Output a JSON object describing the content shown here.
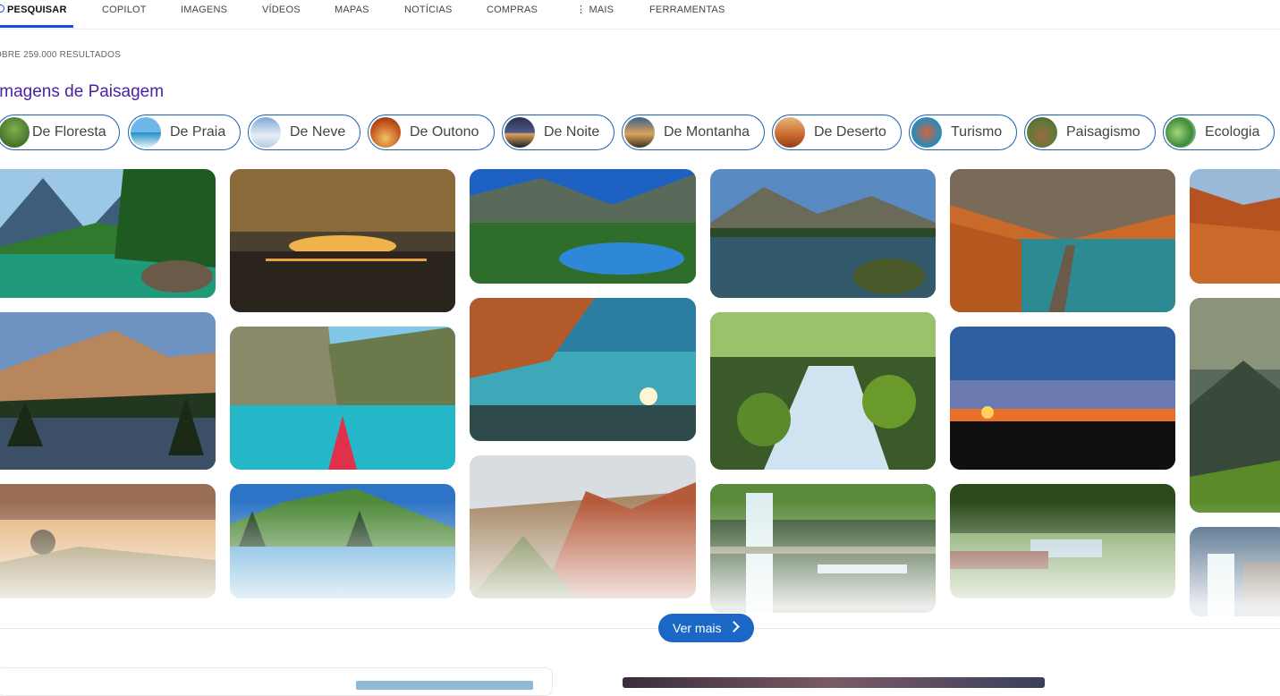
{
  "nav": {
    "search_icon": "search-icon",
    "items": [
      {
        "label": "PESQUISAR",
        "active": true
      },
      {
        "label": "COPILOT"
      },
      {
        "label": "IMAGENS"
      },
      {
        "label": "VÍDEOS"
      },
      {
        "label": "MAPAS"
      },
      {
        "label": "NOTÍCIAS"
      },
      {
        "label": "COMPRAS"
      },
      {
        "label": "⋮ MAIS"
      },
      {
        "label": "FERRAMENTAS"
      }
    ],
    "accent_color": "#174ae4"
  },
  "results_count": "OBRE 259.000 RESULTADOS",
  "section": {
    "title": "Imagens de Paisagem",
    "title_color": "#4b1fa0"
  },
  "chips": [
    {
      "label": "De Floresta"
    },
    {
      "label": "De Praia"
    },
    {
      "label": "De Neve"
    },
    {
      "label": "De Outono"
    },
    {
      "label": "De Noite"
    },
    {
      "label": "De Montanha"
    },
    {
      "label": "De Deserto"
    },
    {
      "label": "Turismo"
    },
    {
      "label": "Paisagismo"
    },
    {
      "label": "Ecologia"
    }
  ],
  "images": [
    {
      "subject": "mountain lake with green valley"
    },
    {
      "subject": "sunset over calm sea with boats"
    },
    {
      "subject": "alpine lake with pond"
    },
    {
      "subject": "mountain lake reflection"
    },
    {
      "subject": "autumn canyon with lake and boardwalk"
    },
    {
      "subject": "autumn mountain forest"
    },
    {
      "subject": "snowy peaks reflected in lake"
    },
    {
      "subject": "turquoise lagoon with kayak"
    },
    {
      "subject": "autumn tree over sunset lake"
    },
    {
      "subject": "mossy forest waterfall"
    },
    {
      "subject": "sunset over ocean"
    },
    {
      "subject": "sun rays over mountains"
    },
    {
      "subject": "misty sunrise over hills"
    },
    {
      "subject": "green meadow lake reflection"
    },
    {
      "subject": "red rock canyon"
    },
    {
      "subject": "terraced waterfalls in forest"
    },
    {
      "subject": "garden with pond"
    },
    {
      "subject": "waterfall cliffs"
    }
  ],
  "more_button": {
    "label": "Ver mais",
    "color": "#1a67c5"
  }
}
